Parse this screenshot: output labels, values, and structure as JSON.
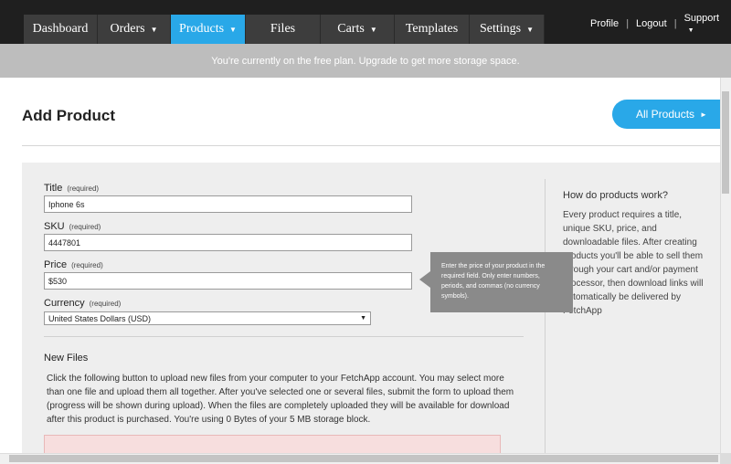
{
  "nav": {
    "tabs": [
      {
        "label": "Dashboard",
        "has_caret": false
      },
      {
        "label": "Orders",
        "has_caret": true
      },
      {
        "label": "Products",
        "has_caret": true,
        "active": true
      },
      {
        "label": "Files",
        "has_caret": false
      },
      {
        "label": "Carts",
        "has_caret": true
      },
      {
        "label": "Templates",
        "has_caret": false
      },
      {
        "label": "Settings",
        "has_caret": true
      }
    ],
    "caret": "▼"
  },
  "util": {
    "profile": "Profile",
    "logout": "Logout",
    "support": "Support",
    "separator": "|"
  },
  "banner": {
    "text": "You're currently on the free plan. Upgrade to get more storage space."
  },
  "header": {
    "title": "Add Product",
    "all_products": "All Products",
    "arrow": "►"
  },
  "form": {
    "required_text": "(required)",
    "title": {
      "label": "Title",
      "value": "Iphone 6s"
    },
    "sku": {
      "label": "SKU",
      "value": "4447801"
    },
    "price": {
      "label": "Price",
      "value": "$530"
    },
    "currency": {
      "label": "Currency",
      "value": "United States Dollars (USD)"
    }
  },
  "tooltip": {
    "text": "Enter the price of your product in the required field. Only enter numbers, periods, and commas (no currency symbols)."
  },
  "new_files": {
    "title": "New Files",
    "description": "Click the following button to upload new files from your computer to your FetchApp account. You may select more than one file and upload them all together. After you've selected one or several files, submit the form to upload them (progress will be shown during upload). When the files are completely uploaded they will be available for download after this product is purchased. You're using 0 Bytes of your 5 MB storage block."
  },
  "help": {
    "title": "How do products work?",
    "text": "Every product requires a title, unique SKU, price, and downloadable files. After creating products you'll be able to sell them through your cart and/or payment processor, then download links will automatically be delivered by FetchApp"
  },
  "colors": {
    "accent": "#29a8e8",
    "nav_bg": "#3d3d3d",
    "topbar_bg": "#1f1f1f",
    "banner_bg": "#bdbdbd",
    "panel_bg": "#eeeeee",
    "tooltip_bg": "#8a8a8a",
    "warning_bg": "#f7dede"
  }
}
